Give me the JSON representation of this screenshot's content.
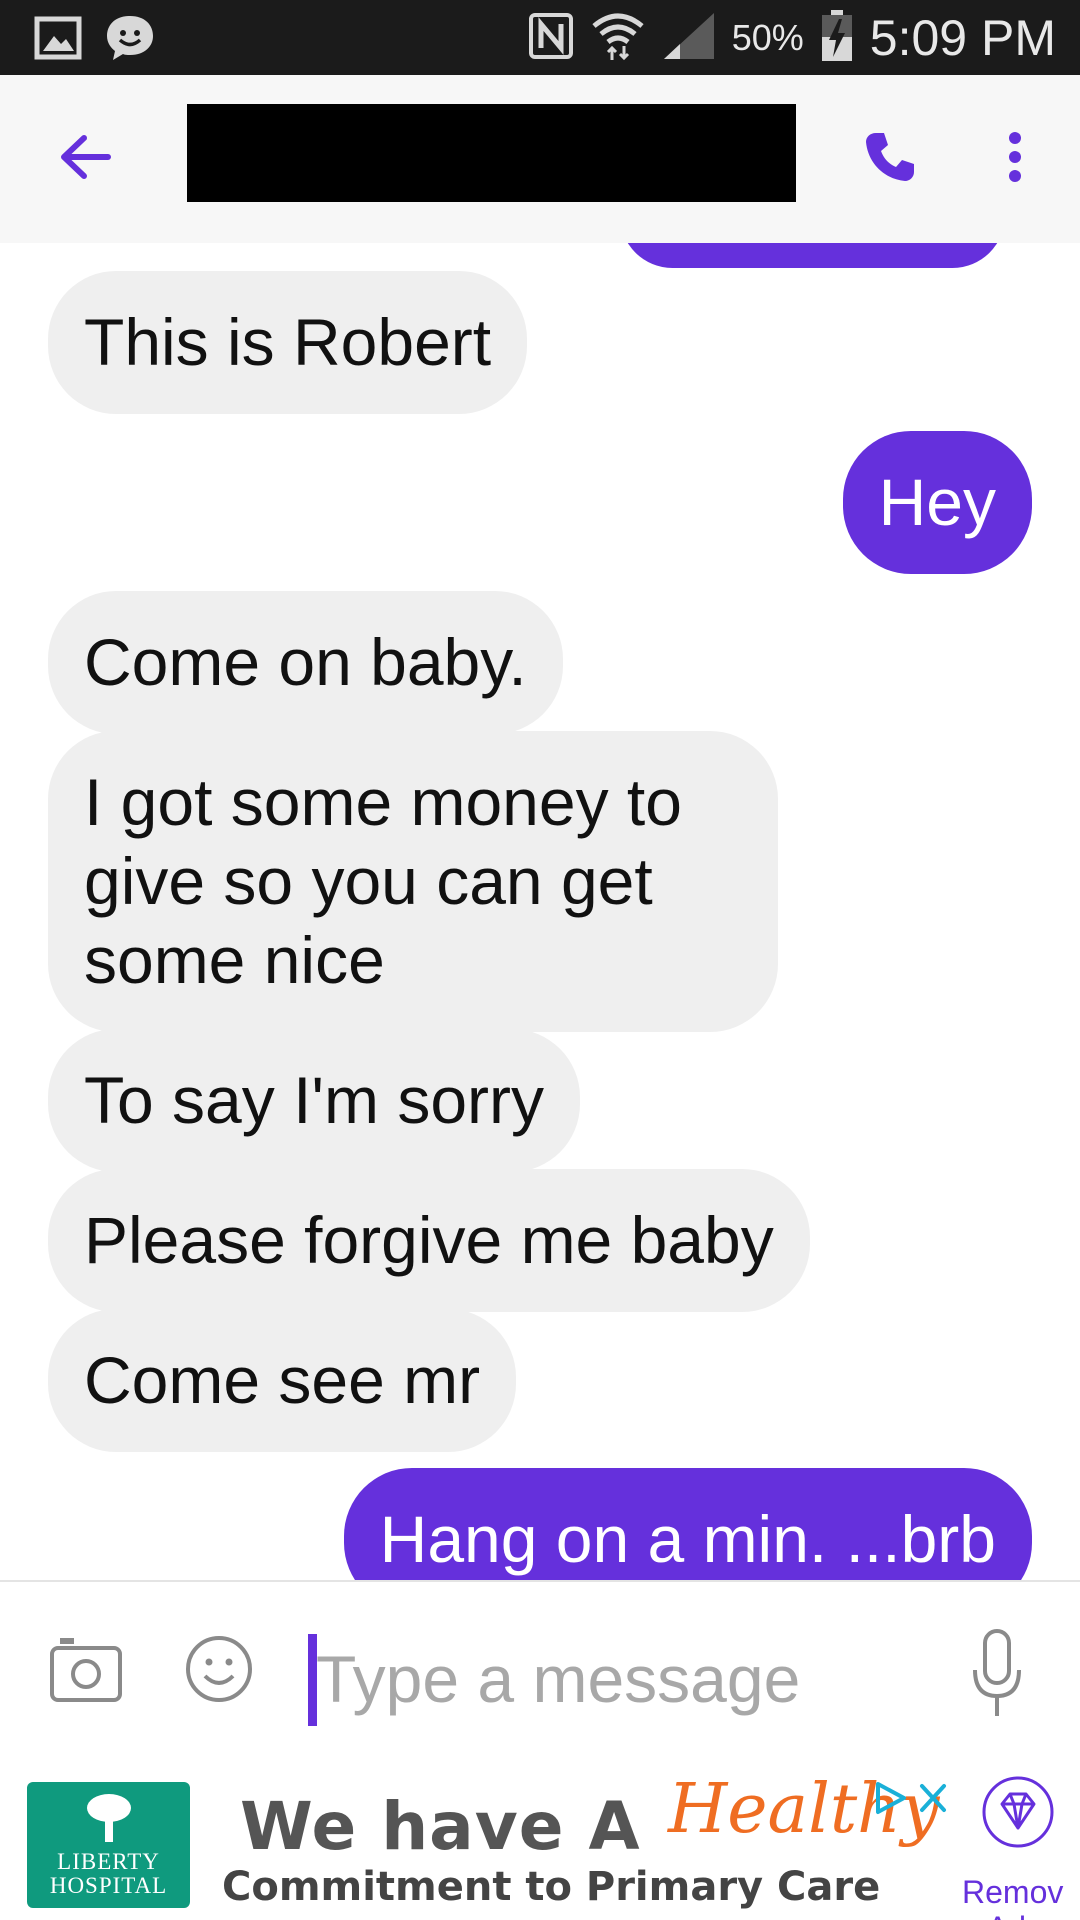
{
  "status_bar": {
    "battery": "50%",
    "time": "5:09 PM",
    "icons": [
      "gallery-icon",
      "chat-notification-icon",
      "nfc-icon",
      "wifi-icon",
      "signal-icon",
      "battery-charging-icon"
    ]
  },
  "toolbar": {
    "title": "",
    "back_icon": "arrow-left-icon",
    "call_icon": "phone-icon",
    "more_icon": "more-vertical-icon"
  },
  "messages": [
    {
      "direction": "in",
      "text": "This is Robert"
    },
    {
      "direction": "out",
      "text": "Hey"
    },
    {
      "direction": "in",
      "text": "Come on baby."
    },
    {
      "direction": "in",
      "text": "I got some money to give so you can get some nice"
    },
    {
      "direction": "in",
      "text": "To say I'm sorry"
    },
    {
      "direction": "in",
      "text": "Please forgive me baby"
    },
    {
      "direction": "in",
      "text": "Come see mr"
    },
    {
      "direction": "out",
      "text": "Hang on a min. ...brb"
    }
  ],
  "input": {
    "placeholder": "Type a message",
    "value": ""
  },
  "ad": {
    "logo_line1": "LIBERTY",
    "logo_line2": "HOSPITAL",
    "headline": "We have A",
    "headline_script": "Healthy",
    "subline": "Commitment to Primary Care",
    "remove_ads_label": "Remove Ads"
  },
  "colors": {
    "accent": "#6530dc",
    "incoming_bubble": "#efefef",
    "status_bar": "#1b1b1b",
    "ad_logo": "#0f9a7e",
    "ad_script": "#ef6d22"
  }
}
